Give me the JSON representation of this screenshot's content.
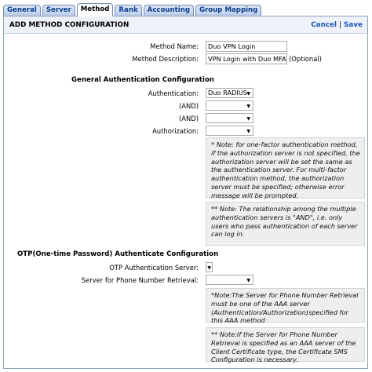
{
  "tabs": [
    "General",
    "Server",
    "Method",
    "Rank",
    "Accounting",
    "Group Mapping"
  ],
  "header": {
    "title": "ADD METHOD CONFIGURATION",
    "cancel": "Cancel",
    "separator": "|",
    "save": "Save"
  },
  "method": {
    "name_label": "Method Name:",
    "name_value": "Duo VPN Login",
    "description_label": "Method Description:",
    "description_value": "VPN Login with Duo MFA",
    "optional_text": "(Optional)"
  },
  "general_auth": {
    "heading": "General Authentication Configuration",
    "authentication_label": "Authentication:",
    "authentication_value": "Duo RADIUS",
    "and1_label": "(AND)",
    "and2_label": "(AND)",
    "authorization_label": "Authorization:",
    "note1": "* Note: for one-factor authentication method, if the authorization server is not specified, the authorization server will be set the same as the authentication server. For multi-factor authentication method, the authorization server must be specified; otherwise error message will be prompted.",
    "note2": "** Note: The relationship among the multiple authentication servers is \"AND\", i.e. only users who pass authentication of each server can log in."
  },
  "otp": {
    "heading": "OTP(One-time Password) Authenticate Configuration",
    "server_label": "OTP Authentication Server:",
    "phone_label": "Server for Phone Number Retrieval:",
    "note1": "*Note:The Server for Phone Number Retrieval must be one of the AAA server (Authentication/Authorization)specified for this AAA method",
    "note2": "** Note:If the Server for Phone Number Retrieval is specified as an AAA server of the Client Certificate type, the Certificate SMS Configuration is necessary."
  }
}
